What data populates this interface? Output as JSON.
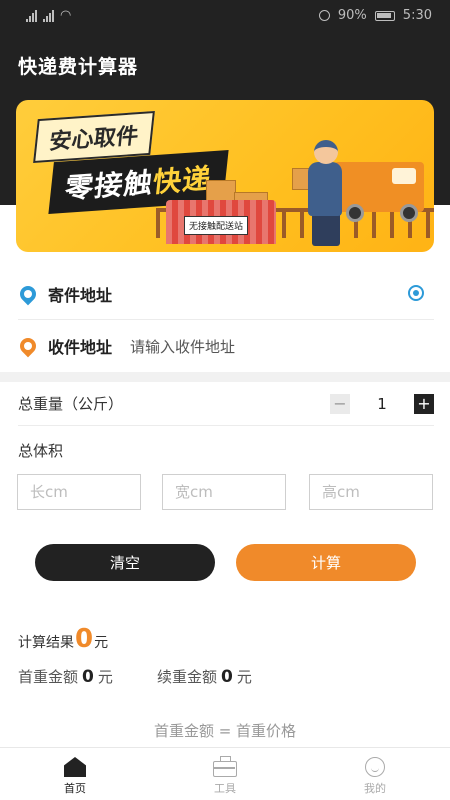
{
  "status_bar": {
    "battery": "90%",
    "time": "5:30"
  },
  "app": {
    "title": "快递费计算器"
  },
  "banner": {
    "tag_top": "安心取件",
    "tag_main_a": "零接触",
    "tag_main_b": "快递",
    "station_sign": "无接触配送站"
  },
  "address": {
    "sender_label": "寄件地址",
    "receiver_label": "收件地址",
    "receiver_placeholder": "请输入收件地址"
  },
  "weight": {
    "label": "总重量（公斤）",
    "value": "1",
    "minus": "−",
    "plus": "+"
  },
  "volume": {
    "label": "总体积",
    "length_placeholder": "长cm",
    "width_placeholder": "宽cm",
    "height_placeholder": "高cm"
  },
  "buttons": {
    "clear": "清空",
    "calculate": "计算"
  },
  "result": {
    "label": "计算结果",
    "value": "0",
    "unit": "元",
    "first_weight_label": "首重金额",
    "first_weight_value": "0",
    "continued_weight_label": "续重金额",
    "continued_weight_value": "0",
    "formula": "首重金额 = 首重价格"
  },
  "nav": {
    "home": "首页",
    "tools": "工具",
    "mine": "我的"
  },
  "colors": {
    "accent": "#f08a2a",
    "dark": "#222222",
    "blue_pin": "#2d9ad8"
  }
}
